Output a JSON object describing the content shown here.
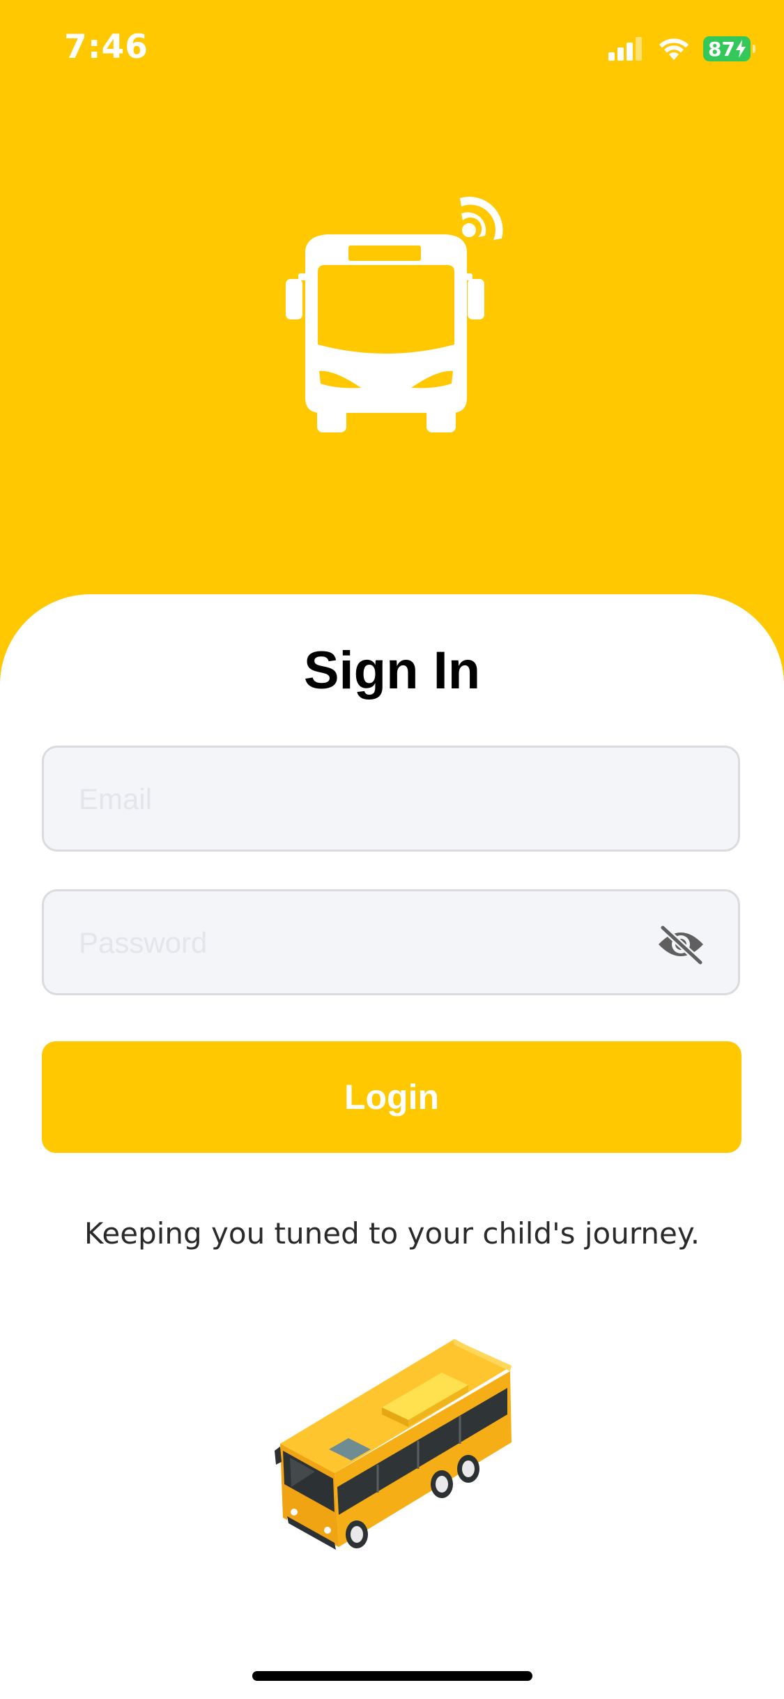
{
  "status_bar": {
    "time": "7:46",
    "battery": "87"
  },
  "colors": {
    "brand": "#FFC800",
    "battery": "#34C759",
    "field_bg": "#F4F5F9"
  },
  "header": {
    "logo_icon": "bus-with-signal-icon"
  },
  "sign_in": {
    "title": "Sign In",
    "email_placeholder": "Email",
    "email_value": "",
    "password_placeholder": "Password",
    "password_value": "",
    "password_toggle_icon": "eye-off-icon",
    "login_label": "Login",
    "tagline": "Keeping you tuned to your child's journey."
  },
  "illustration": {
    "icon": "school-bus-illustration"
  }
}
